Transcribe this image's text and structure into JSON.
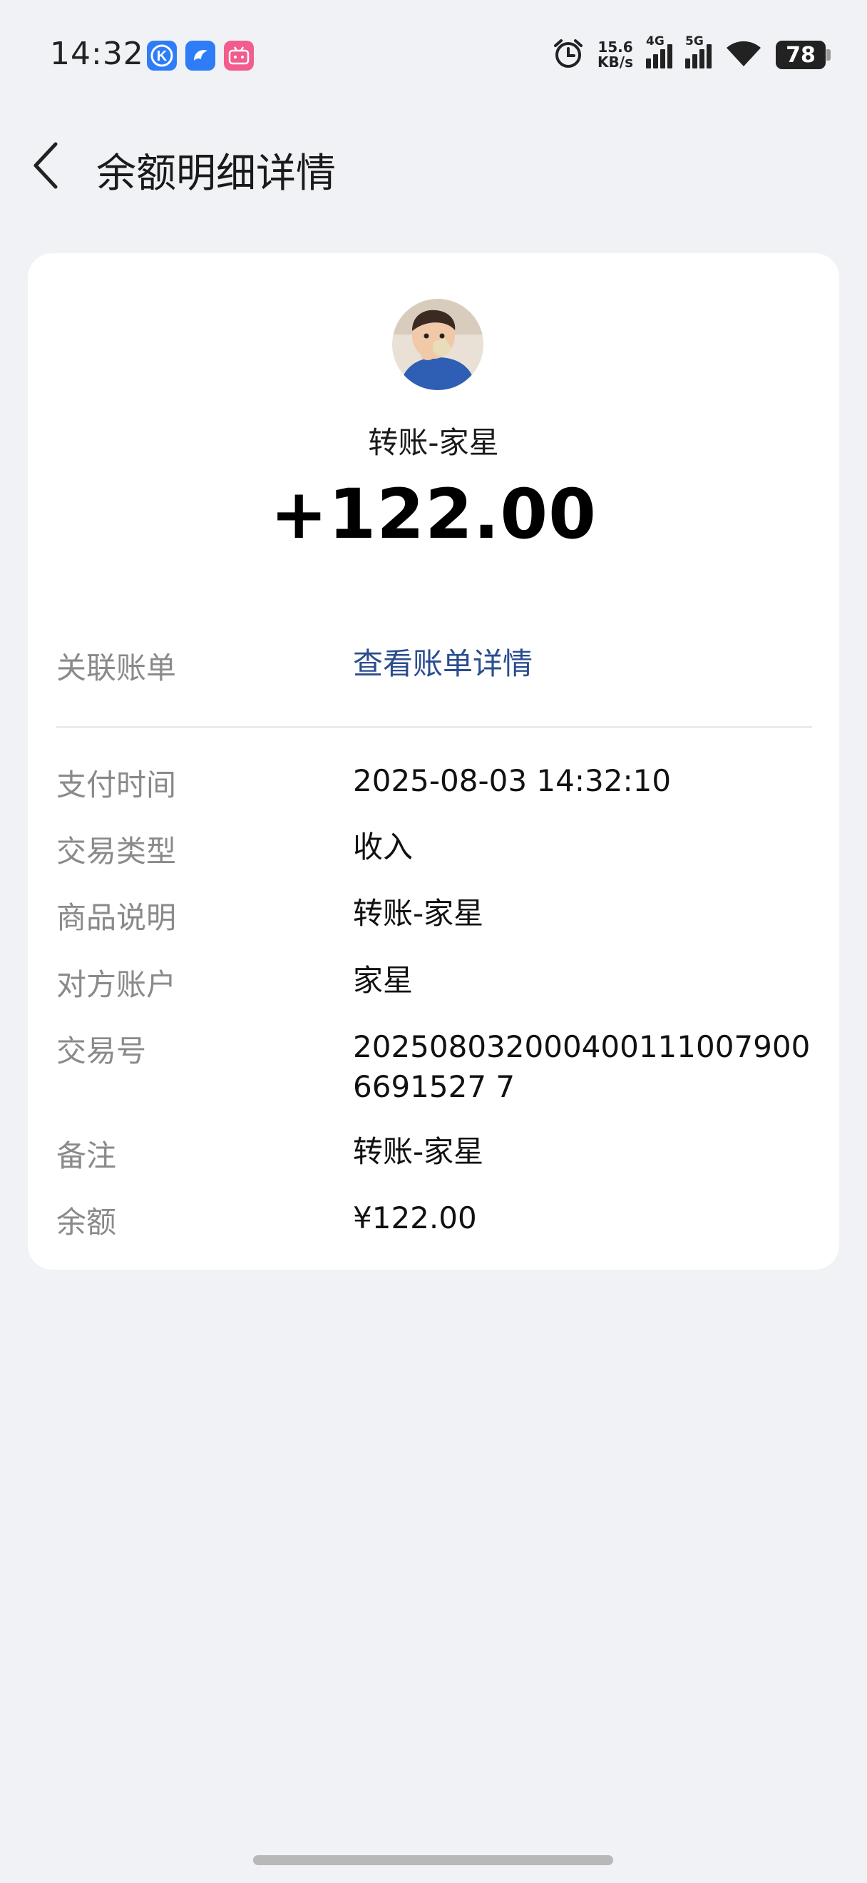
{
  "status_bar": {
    "time": "14:32",
    "net_speed_value": "15.6",
    "net_speed_unit": "KB/s",
    "signal_1_label": "4G",
    "signal_2_label": "5G",
    "battery": "78",
    "icons": [
      "k-app-icon",
      "dolphin-app-icon",
      "bilibili-app-icon",
      "alarm-icon",
      "signal-icon",
      "wifi-icon",
      "battery-icon"
    ]
  },
  "header": {
    "title": "余额明细详情"
  },
  "transaction": {
    "payer": "转账-家星",
    "amount": "+122.00"
  },
  "linked_bill": {
    "label": "关联账单",
    "link_text": "查看账单详情"
  },
  "details": [
    {
      "label": "支付时间",
      "value": "2025-08-03 14:32:10"
    },
    {
      "label": "交易类型",
      "value": "收入"
    },
    {
      "label": "商品说明",
      "value": "转账-家星"
    },
    {
      "label": "对方账户",
      "value": "家星"
    },
    {
      "label": "交易号",
      "value": "2025080320004001110079006691527 7"
    },
    {
      "label": "备注",
      "value": "转账-家星"
    },
    {
      "label": "余额",
      "value": "¥122.00"
    }
  ],
  "colors": {
    "background": "#f1f2f6",
    "card": "#ffffff",
    "link": "#2a4d8f",
    "label": "#8a8a8a"
  }
}
